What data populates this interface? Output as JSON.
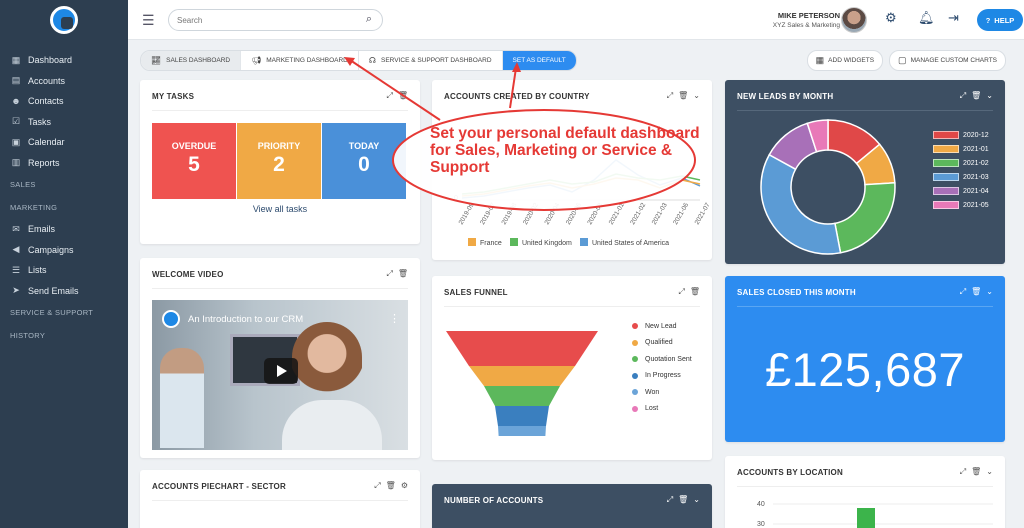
{
  "sidebar": {
    "items": [
      {
        "label": "Dashboard",
        "icon": "dashboard-icon",
        "glyph": "▦"
      },
      {
        "label": "Accounts",
        "icon": "building-icon",
        "glyph": "▤"
      },
      {
        "label": "Contacts",
        "icon": "users-icon",
        "glyph": "☻"
      },
      {
        "label": "Tasks",
        "icon": "checkbox-icon",
        "glyph": "☑"
      },
      {
        "label": "Calendar",
        "icon": "calendar-icon",
        "glyph": "▣"
      },
      {
        "label": "Reports",
        "icon": "report-icon",
        "glyph": "▥"
      }
    ],
    "section_sales": "SALES",
    "section_marketing": "MARKETING",
    "marketing_items": [
      {
        "label": "Emails",
        "icon": "envelope-icon",
        "glyph": "✉"
      },
      {
        "label": "Campaigns",
        "icon": "megaphone-icon",
        "glyph": "◀"
      },
      {
        "label": "Lists",
        "icon": "list-icon",
        "glyph": "☰"
      },
      {
        "label": "Send Emails",
        "icon": "paper-plane-icon",
        "glyph": "➤"
      }
    ],
    "section_service": "SERVICE & SUPPORT",
    "section_history": "HISTORY"
  },
  "topbar": {
    "search_placeholder": "Search",
    "user_name": "MIKE PETERSON",
    "user_company": "XYZ Sales & Marketing",
    "help_label": "HELP"
  },
  "tabs": {
    "sales": "SALES DASHBOARD",
    "marketing": "MARKETING DASHBOARD",
    "service": "SERVICE & SUPPORT DASHBOARD",
    "set_default": "SET AS DEFAULT",
    "add_widgets": "ADD WIDGETS",
    "manage_charts": "MANAGE CUSTOM CHARTS"
  },
  "my_tasks": {
    "title": "MY TASKS",
    "overdue_label": "OVERDUE",
    "overdue_value": "5",
    "priority_label": "PRIORITY",
    "priority_value": "2",
    "today_label": "TODAY",
    "today_value": "0",
    "view_all": "View all tasks",
    "colors": {
      "overdue": "#ef5350",
      "priority": "#f0a945",
      "today": "#4a90d9"
    }
  },
  "welcome_video": {
    "title": "WELCOME VIDEO",
    "video_title": "An Introduction to our CRM"
  },
  "accounts_piechart": {
    "title": "ACCOUNTS PIECHART - SECTOR"
  },
  "accounts_by_country": {
    "title": "ACCOUNTS CREATED BY COUNTRY",
    "chart_data": {
      "type": "line",
      "x": [
        "2019-09",
        "2019-07",
        "2019-08",
        "2020-02",
        "2020-04",
        "2020-06",
        "2020-08",
        "2021-01",
        "2021-02",
        "2021-03",
        "2021-06",
        "2021-07"
      ],
      "series": [
        {
          "name": "France",
          "color": "#f0a945"
        },
        {
          "name": "United Kingdom",
          "color": "#5cb85c"
        },
        {
          "name": "United States of America",
          "color": "#5b9bd5"
        }
      ],
      "y_tick": "0"
    }
  },
  "sales_funnel": {
    "title": "SALES FUNNEL",
    "chart_data": {
      "type": "bar",
      "categories": [
        "New Lead",
        "Qualified",
        "Quotation Sent",
        "In Progress",
        "Won",
        "Lost"
      ],
      "colors": [
        "#e74c4c",
        "#f0a945",
        "#5cb85c",
        "#3a7fbf",
        "#6ba4d8",
        "#e879b8"
      ]
    }
  },
  "number_of_accounts": {
    "title": "NUMBER OF ACCOUNTS"
  },
  "new_leads": {
    "title": "NEW LEADS BY MONTH",
    "chart_data": {
      "type": "pie",
      "categories": [
        "2020-12",
        "2021-01",
        "2021-02",
        "2021-03",
        "2021-04",
        "2021-05"
      ],
      "values": [
        14,
        10,
        23,
        36,
        12,
        5
      ],
      "colors": [
        "#e04848",
        "#f0a945",
        "#5cb85c",
        "#5b9bd5",
        "#a870b8",
        "#e879b8"
      ]
    }
  },
  "sales_closed": {
    "title": "SALES CLOSED THIS MONTH",
    "amount": "£125,687"
  },
  "accounts_by_location": {
    "title": "ACCOUNTS BY LOCATION",
    "chart_data": {
      "type": "bar",
      "y_ticks": [
        "40",
        "30"
      ]
    }
  },
  "annotation": {
    "text": "Set your personal default dashboard for Sales, Marketing or Service & Support",
    "color": "#e53935"
  }
}
